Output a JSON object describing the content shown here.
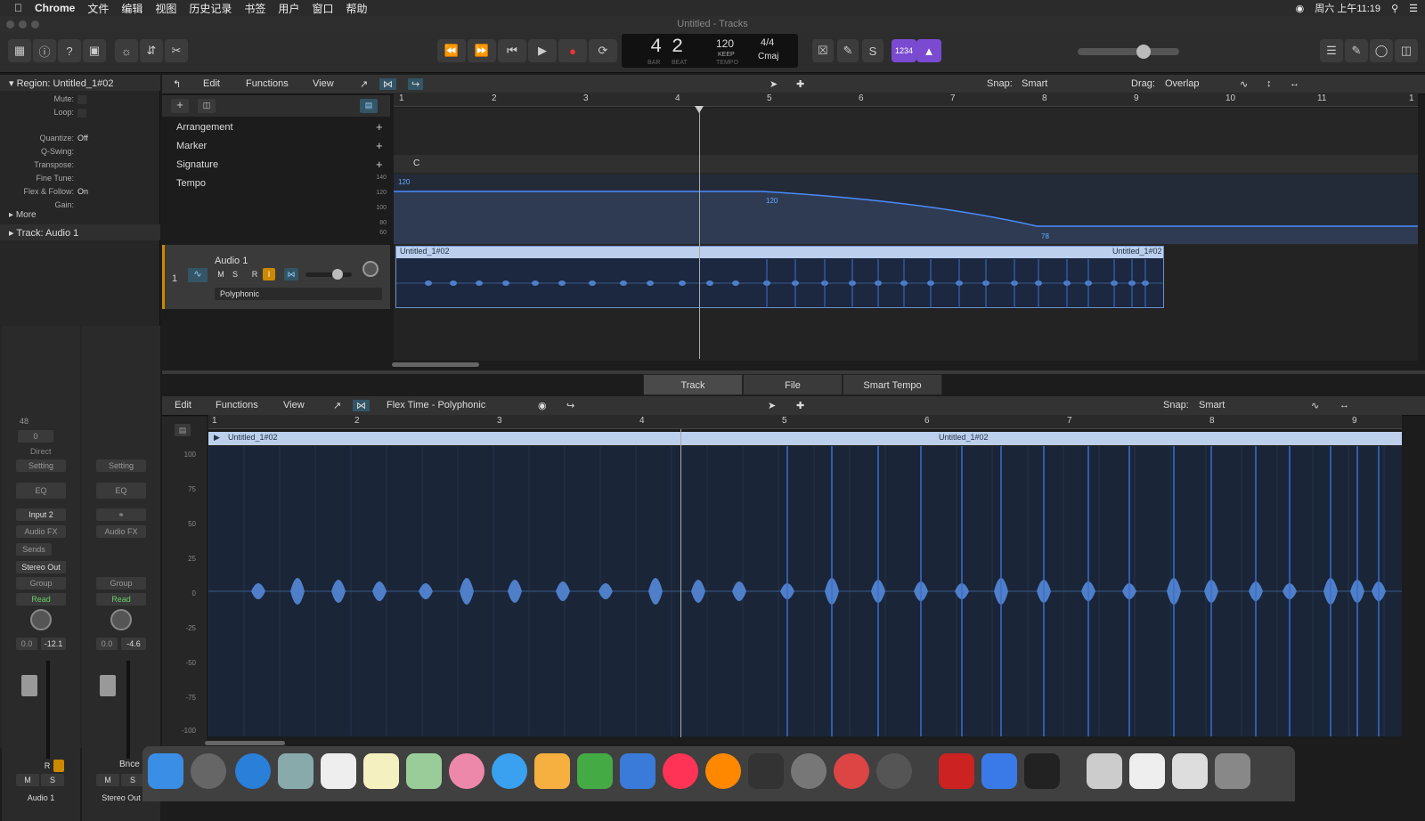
{
  "menubar": {
    "app": "Chrome",
    "items": [
      "文件",
      "编辑",
      "视图",
      "历史记录",
      "书签",
      "用户",
      "窗口",
      "帮助"
    ],
    "clock": "周六 上午11:19"
  },
  "window": {
    "title": "Untitled - Tracks"
  },
  "lcd": {
    "bar": "4",
    "beat": "2",
    "bar_label": "BAR",
    "beat_label": "BEAT",
    "tempo": "120",
    "tempo_mode": "KEEP",
    "tempo_label": "TEMPO",
    "signature": "4/4",
    "key": "Cmaj",
    "count_in": "1234"
  },
  "inspector": {
    "region": "Region: Untitled_1#02",
    "rows": [
      {
        "label": "Mute:",
        "value": ""
      },
      {
        "label": "Loop:",
        "value": ""
      },
      {
        "label": "Quantize:",
        "value": "Off"
      },
      {
        "label": "Q-Swing:",
        "value": ""
      },
      {
        "label": "Transpose:",
        "value": ""
      },
      {
        "label": "Fine Tune:",
        "value": ""
      },
      {
        "label": "Flex & Follow:",
        "value": "On"
      },
      {
        "label": "Gain:",
        "value": ""
      }
    ],
    "more": "More",
    "track": "Track:  Audio 1"
  },
  "strip1": {
    "val48": "48",
    "val0": "0",
    "direct": "Direct",
    "setting": "Setting",
    "eq": "EQ",
    "input": "Input 2",
    "audiofx": "Audio FX",
    "sends": "Sends",
    "output": "Stereo Out",
    "group": "Group",
    "read": "Read",
    "vol": "0.0",
    "peak": "-12.1",
    "name": "Audio 1",
    "r": "R",
    "m": "M",
    "s": "S"
  },
  "strip2": {
    "setting": "Setting",
    "eq": "EQ",
    "audiofx": "Audio FX",
    "group": "Group",
    "read": "Read",
    "vol": "0.0",
    "peak": "-4.6",
    "name": "Stereo Out",
    "bnce": "Bnce",
    "m": "M",
    "s": "S"
  },
  "tracks_menu": {
    "edit": "Edit",
    "functions": "Functions",
    "view": "View",
    "snap_label": "Snap:",
    "snap": "Smart",
    "drag_label": "Drag:",
    "drag": "Overlap"
  },
  "global": {
    "arrangement": "Arrangement",
    "marker": "Marker",
    "signature": "Signature",
    "tempo": "Tempo",
    "sig_value": "C",
    "tempo_ticks": [
      "140",
      "120",
      "100",
      "80",
      "60"
    ],
    "tempo_points": [
      "120",
      "120",
      "78"
    ]
  },
  "track": {
    "num": "1",
    "name": "Audio 1",
    "mode": "Polyphonic",
    "m": "M",
    "s": "S",
    "r": "R",
    "i": "I"
  },
  "region": {
    "name_left": "Untitled_1#02",
    "name_right": "Untitled_1#02"
  },
  "ruler_top": [
    "1",
    "2",
    "3",
    "4",
    "5",
    "6",
    "7",
    "8",
    "9",
    "10",
    "11",
    "1"
  ],
  "editor": {
    "tabs": [
      "Track",
      "File",
      "Smart Tempo"
    ],
    "edit": "Edit",
    "functions": "Functions",
    "view": "View",
    "flex": "Flex Time - Polyphonic",
    "snap_label": "Snap:",
    "snap": "Smart",
    "ruler": [
      "1",
      "2",
      "3",
      "4",
      "5",
      "6",
      "7",
      "8",
      "9"
    ],
    "region_left": "Untitled_1#02",
    "region_right": "Untitled_1#02",
    "yticks": [
      "100",
      "75",
      "50",
      "25",
      "0",
      "-25",
      "-50",
      "-75",
      "-100"
    ]
  }
}
